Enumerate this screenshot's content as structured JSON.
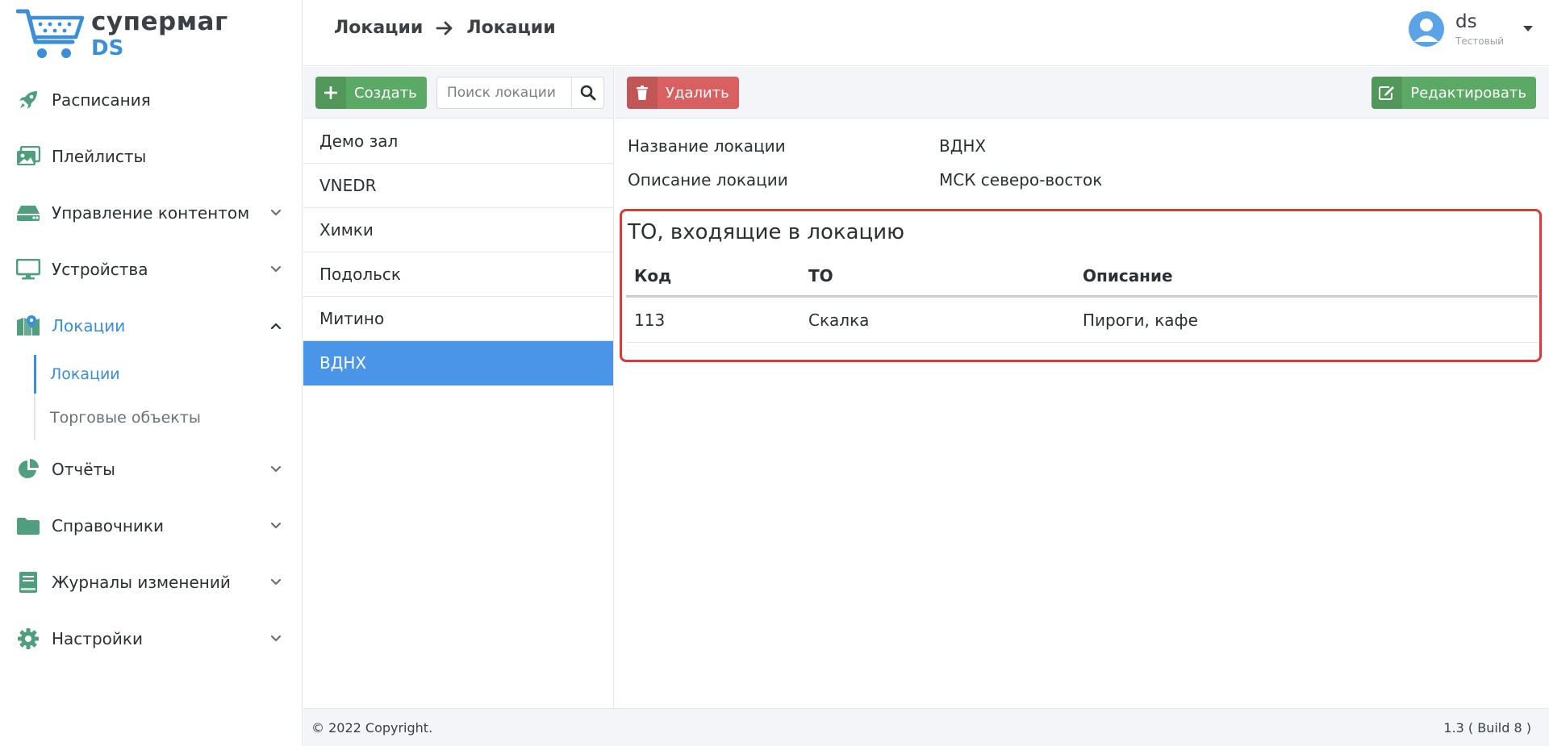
{
  "app": {
    "logo_title": "супермаг",
    "logo_subtitle": "DS"
  },
  "sidebar": {
    "items": [
      {
        "label": "Расписания",
        "icon": "rocket-icon"
      },
      {
        "label": "Плейлисты",
        "icon": "images-icon"
      },
      {
        "label": "Управление контентом",
        "icon": "hdd-icon"
      },
      {
        "label": "Устройства",
        "icon": "monitor-icon"
      },
      {
        "label": "Локации",
        "icon": "map-icon"
      },
      {
        "label": "Отчёты",
        "icon": "pie-chart-icon"
      },
      {
        "label": "Справочники",
        "icon": "folder-icon"
      },
      {
        "label": "Журналы изменений",
        "icon": "book-icon"
      },
      {
        "label": "Настройки",
        "icon": "gear-icon"
      }
    ],
    "sub_items": [
      {
        "label": "Локации"
      },
      {
        "label": "Торговые объекты"
      }
    ]
  },
  "header": {
    "breadcrumb": [
      "Локации",
      "Локации"
    ],
    "user_name": "ds",
    "user_role": "Тестовый"
  },
  "locations": {
    "create_label": "Создать",
    "search_placeholder": "Поиск локации",
    "items": [
      "Демо зал",
      "VNEDR",
      "Химки",
      "Подольск",
      "Митино",
      "ВДНХ"
    ],
    "selected": "ВДНХ"
  },
  "detail": {
    "delete_label": "Удалить",
    "edit_label": "Редактировать",
    "name_label": "Название локации",
    "name_value": "ВДНХ",
    "desc_label": "Описание локации",
    "desc_value": "МСК северо-восток",
    "section_title": "ТО, входящие в локацию",
    "table": {
      "headers": [
        "Код",
        "ТО",
        "Описание"
      ],
      "rows": [
        [
          "113",
          "Скалка",
          "Пироги, кафе"
        ]
      ]
    }
  },
  "footer": {
    "copyright": "© 2022 Copyright.",
    "version": "1.3 ( Build 8 )"
  },
  "colors": {
    "accent": "#3a8fd8",
    "icon_green": "#4f9e7e",
    "button_green": "#5aa964",
    "button_red": "#d96060",
    "highlight_red": "#d93a3a"
  }
}
